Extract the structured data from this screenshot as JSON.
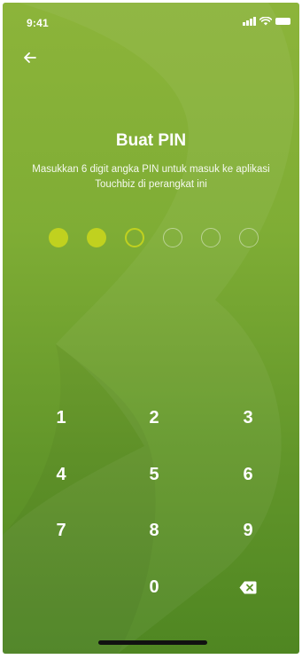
{
  "status_bar": {
    "time": "9:41",
    "icons": [
      "signal-icon",
      "wifi-icon",
      "battery-icon"
    ]
  },
  "header": {
    "back_icon": "arrow-left-icon",
    "title": "Buat PIN",
    "subtitle": "Masukkan 6 digit angka PIN untuk masuk ke aplikasi Touchbiz di perangkat ini"
  },
  "pin": {
    "length": 6,
    "entered": 2,
    "filled_color": "#c0d11f"
  },
  "keypad": {
    "keys": [
      "1",
      "2",
      "3",
      "4",
      "5",
      "6",
      "7",
      "8",
      "9",
      "0"
    ],
    "delete_icon": "backspace-icon"
  },
  "colors": {
    "background_top": "#8cb43a",
    "background_bottom": "#4f8622",
    "accent": "#c0d11f"
  }
}
